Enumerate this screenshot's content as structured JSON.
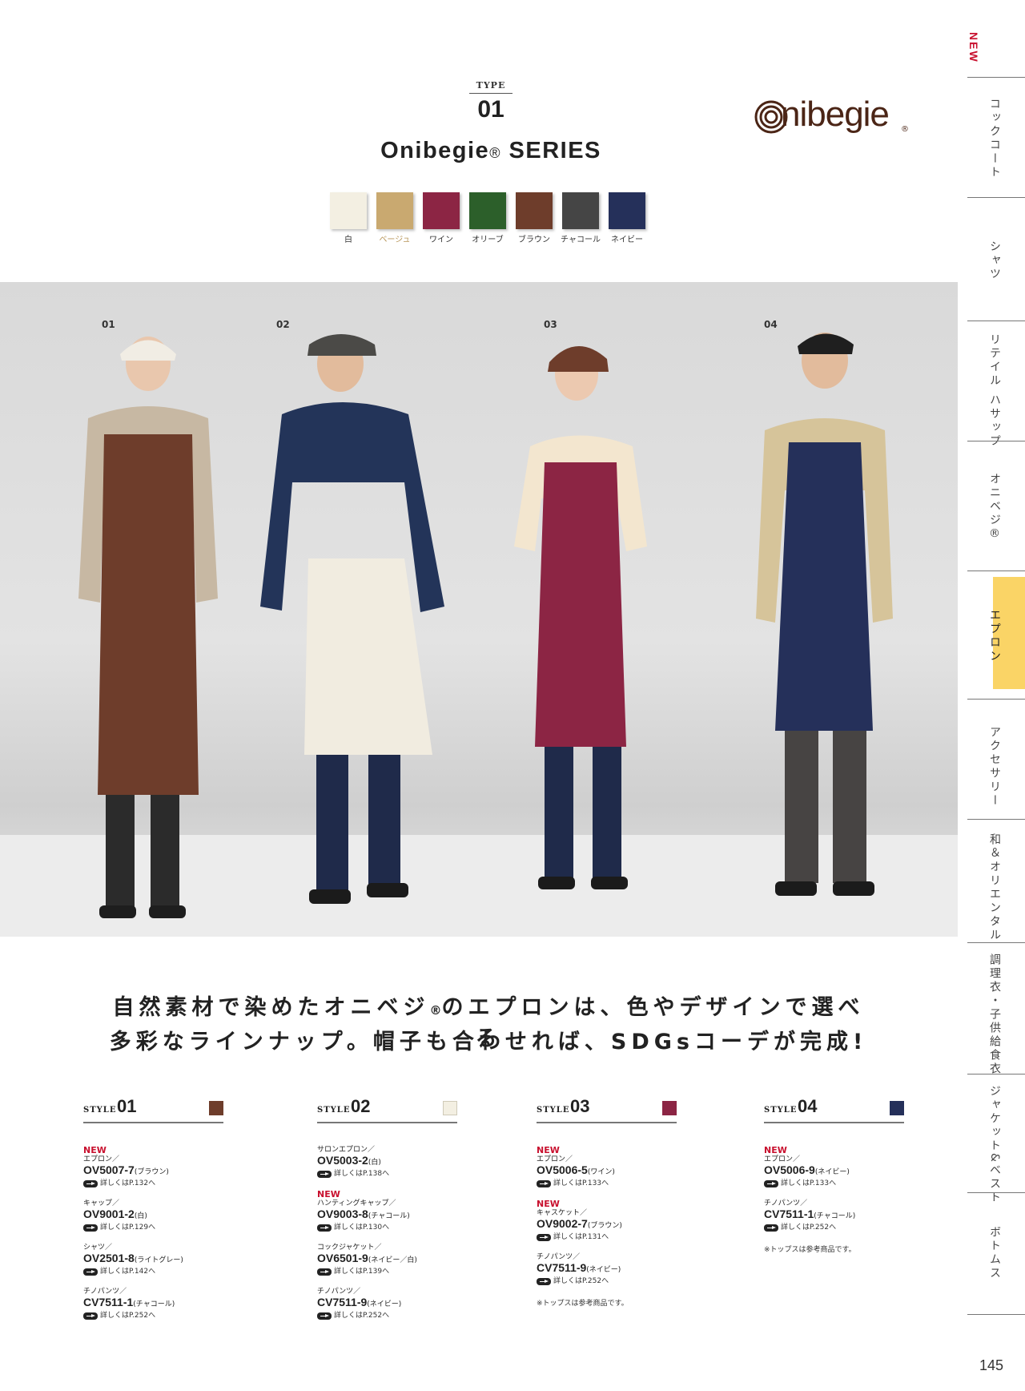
{
  "header": {
    "type_label": "TYPE",
    "type_number": "01",
    "series_name": "Onibegie",
    "series_reg": "®",
    "series_suffix": " SERIES",
    "logo_text": "nibegie",
    "logo_reg": "®"
  },
  "swatches": [
    {
      "label": "白",
      "color": "#f3efe2",
      "label_color": "#333333"
    },
    {
      "label": "ベージュ",
      "color": "#c9a970",
      "label_color": "#b8965a"
    },
    {
      "label": "ワイン",
      "color": "#8c2544",
      "label_color": "#333333"
    },
    {
      "label": "オリーブ",
      "color": "#2c5f2a",
      "label_color": "#333333"
    },
    {
      "label": "ブラウン",
      "color": "#6e3d2b",
      "label_color": "#333333"
    },
    {
      "label": "チャコール",
      "color": "#454545",
      "label_color": "#333333"
    },
    {
      "label": "ネイビー",
      "color": "#25305a",
      "label_color": "#333333"
    }
  ],
  "photo": {
    "numbers": [
      "01",
      "02",
      "03",
      "04"
    ]
  },
  "catch_copy": {
    "line1a": "自然素材で染めたオニベジ",
    "line1_reg": "®",
    "line1b": "のエプロンは、色やデザインで選べる",
    "line2": "多彩なラインナップ。帽子も合わせれば、SDGsコーデが完成!"
  },
  "styles": [
    {
      "word": "STYLE",
      "number": "01",
      "color": "#6e3d2b",
      "items": [
        {
          "new": "NEW",
          "category": "エプロン／",
          "code": "OV5007-7",
          "color_name": "(ブラウン)",
          "ref": "詳しくはP.132へ"
        },
        {
          "new": "",
          "category": "キャップ／",
          "code": "OV9001-2",
          "color_name": "(白)",
          "ref": "詳しくはP.129へ"
        },
        {
          "new": "",
          "category": "シャツ／",
          "code": "OV2501-8",
          "color_name": "(ライトグレー)",
          "ref": "詳しくはP.142へ"
        },
        {
          "new": "",
          "category": "チノパンツ／",
          "code": "CV7511-1",
          "color_name": "(チャコール)",
          "ref": "詳しくはP.252へ"
        }
      ],
      "note": ""
    },
    {
      "word": "STYLE",
      "number": "02",
      "color": "#f3efe2",
      "items": [
        {
          "new": "",
          "category": "サロンエプロン／",
          "code": "OV5003-2",
          "color_name": "(白)",
          "ref": "詳しくはP.138へ"
        },
        {
          "new": "NEW",
          "category": "ハンティングキャップ／",
          "code": "OV9003-8",
          "color_name": "(チャコール)",
          "ref": "詳しくはP.130へ"
        },
        {
          "new": "",
          "category": "コックジャケット／",
          "code": "OV6501-9",
          "color_name": "(ネイビー／白)",
          "ref": "詳しくはP.139へ"
        },
        {
          "new": "",
          "category": "チノパンツ／",
          "code": "CV7511-9",
          "color_name": "(ネイビー)",
          "ref": "詳しくはP.252へ"
        }
      ],
      "note": ""
    },
    {
      "word": "STYLE",
      "number": "03",
      "color": "#8c2544",
      "items": [
        {
          "new": "NEW",
          "category": "エプロン／",
          "code": "OV5006-5",
          "color_name": "(ワイン)",
          "ref": "詳しくはP.133へ"
        },
        {
          "new": "NEW",
          "category": "キャスケット／",
          "code": "OV9002-7",
          "color_name": "(ブラウン)",
          "ref": "詳しくはP.131へ"
        },
        {
          "new": "",
          "category": "チノパンツ／",
          "code": "CV7511-9",
          "color_name": "(ネイビー)",
          "ref": "詳しくはP.252へ"
        }
      ],
      "note": "※トップスは参考商品です。"
    },
    {
      "word": "STYLE",
      "number": "04",
      "color": "#25305a",
      "items": [
        {
          "new": "NEW",
          "category": "エプロン／",
          "code": "OV5006-9",
          "color_name": "(ネイビー)",
          "ref": "詳しくはP.133へ"
        },
        {
          "new": "",
          "category": "チノパンツ／",
          "code": "CV7511-1",
          "color_name": "(チャコール)",
          "ref": "詳しくはP.252へ"
        }
      ],
      "note": "※トップスは参考商品です。"
    }
  ],
  "side_index": {
    "new_label": "NEW",
    "items": [
      "コックコート",
      "シャツ",
      "リテイル ハサップ",
      "オニベジ®",
      "エプロン",
      "アクセサリー",
      "和＆オリエンタル",
      "調理衣・子供給食衣",
      "ジャケット&ベスト",
      "ボトムス"
    ],
    "active": "エプロン"
  },
  "page_number": "145"
}
